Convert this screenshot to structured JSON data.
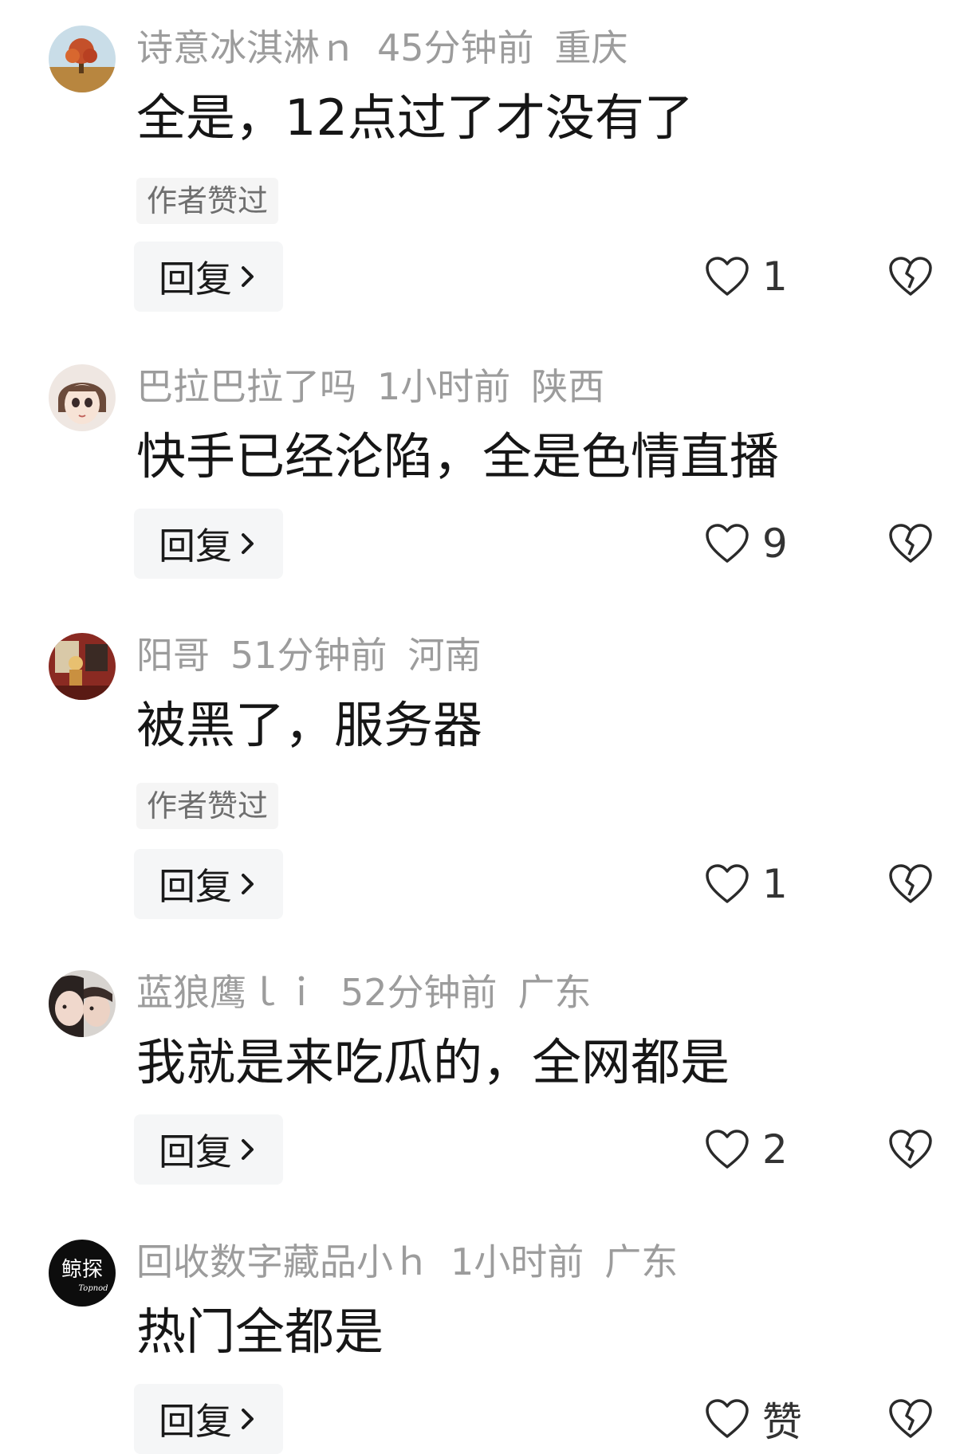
{
  "comments": [
    {
      "username": "诗意冰淇淋ｎ",
      "time": "45分钟前",
      "location": "重庆",
      "text": "全是，12点过了才没有了",
      "tag": "作者赞过",
      "reply_label": "回复",
      "likes": "1",
      "avatar_icon": "autumn-tree-avatar"
    },
    {
      "username": "巴拉巴拉了吗",
      "time": "1小时前",
      "location": "陕西",
      "text": "快手已经沦陷，全是色情直播",
      "reply_label": "回复",
      "likes": "9",
      "avatar_icon": "cartoon-girl-avatar"
    },
    {
      "username": "阳哥",
      "time": "51分钟前",
      "location": "河南",
      "text": "被黑了，服务器",
      "tag": "作者赞过",
      "reply_label": "回复",
      "likes": "1",
      "avatar_icon": "room-photo-avatar"
    },
    {
      "username": "蓝狼鹰ｌｉ",
      "time": "52分钟前",
      "location": "广东",
      "text": "我就是来吃瓜的，全网都是",
      "reply_label": "回复",
      "likes": "2",
      "avatar_icon": "selfie-avatar"
    },
    {
      "username": "回收数字藏品小ｈ",
      "time": "1小时前",
      "location": "广东",
      "text": "热门全都是",
      "reply_label": "回复",
      "likes": "赞",
      "avatar_icon": "logo-avatar",
      "avatar_text": "鲸探",
      "avatar_subtext": "Topnod"
    }
  ],
  "colors": {
    "meta": "#9c9c9c",
    "text": "#161616",
    "button_bg": "#f5f6f7"
  }
}
